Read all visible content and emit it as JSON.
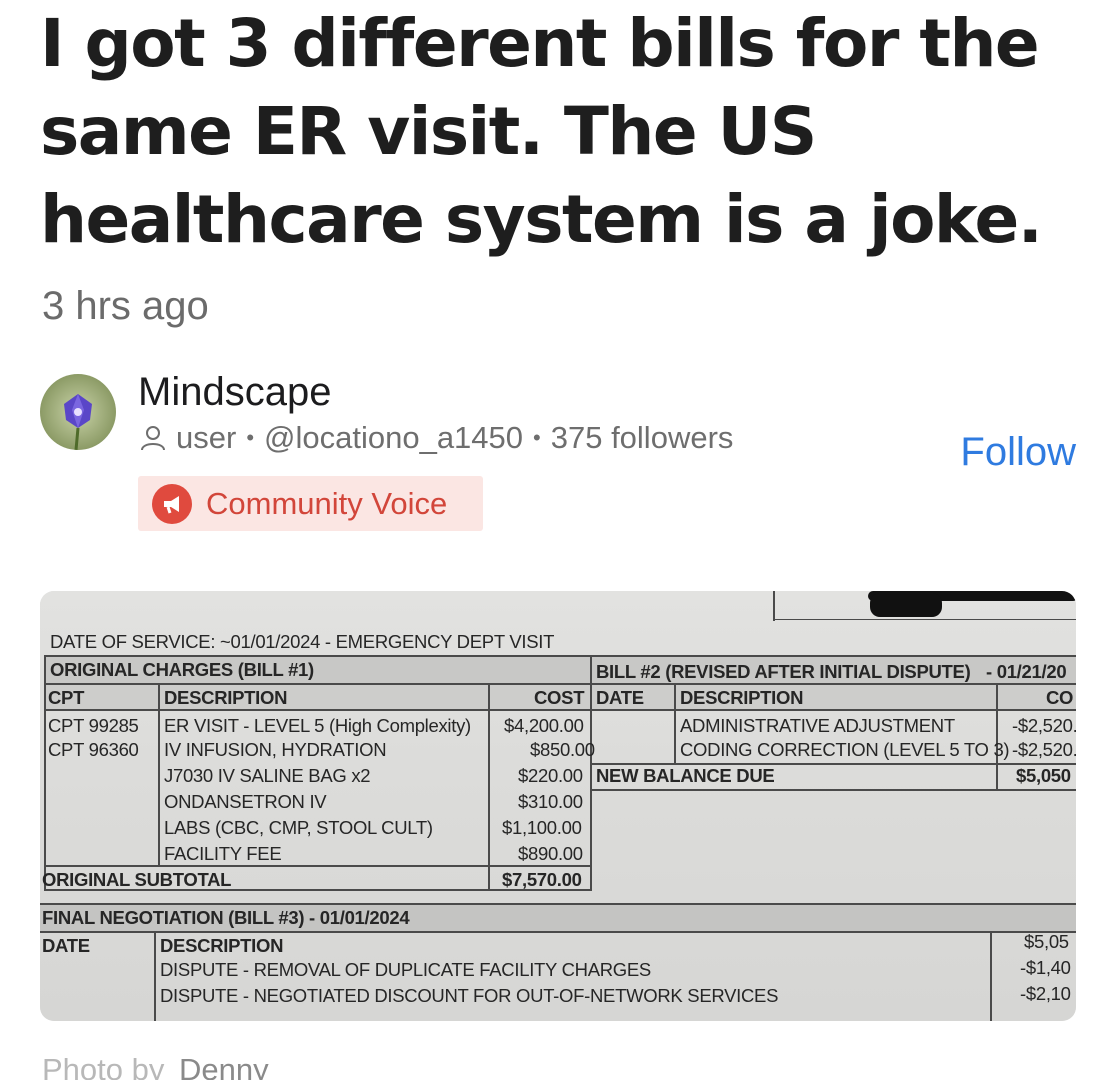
{
  "article": {
    "title": "I got 3 different bills for the same ER visit. The US healthcare system is a joke.",
    "timestamp": "3 hrs ago"
  },
  "author": {
    "name": "Mindscape",
    "role": "user",
    "handle": "@locationo_a1450",
    "followers": "375 followers",
    "follow_label": "Follow",
    "badge_label": "Community Voice",
    "role_icon": "user-icon",
    "badge_icon": "megaphone-icon"
  },
  "photo": {
    "caption_prefix": "Photo by",
    "caption_name": "Denny",
    "bill": {
      "date_of_service": "DATE OF SERVICE: ~01/01/2024 - EMERGENCY DEPT VISIT",
      "bill1": {
        "header": "ORIGINAL CHARGES (BILL #1)",
        "columns": [
          "CPT",
          "DESCRIPTION",
          "COST"
        ],
        "rows": [
          {
            "cpt": "CPT 99285",
            "desc": "ER VISIT - LEVEL 5 (High Complexity)",
            "cost": "$4,200.00"
          },
          {
            "cpt": "CPT 96360",
            "desc": "IV INFUSION, HYDRATION",
            "cost": "$850.00"
          },
          {
            "cpt": "",
            "desc": "J7030 IV SALINE BAG x2",
            "cost": "$220.00"
          },
          {
            "cpt": "",
            "desc": "ONDANSETRON IV",
            "cost": "$310.00"
          },
          {
            "cpt": "",
            "desc": "LABS (CBC, CMP, STOOL CULT)",
            "cost": "$1,100.00"
          },
          {
            "cpt": "",
            "desc": "FACILITY FEE",
            "cost": "$890.00"
          }
        ],
        "subtotal_label": "ORIGINAL SUBTOTAL",
        "subtotal_value": "$7,570.00"
      },
      "bill2": {
        "header": "BILL #2 (REVISED AFTER INITIAL DISPUTE)",
        "header_date": "- 01/21/20",
        "columns": [
          "DATE",
          "DESCRIPTION",
          "CO"
        ],
        "rows": [
          {
            "desc": "ADMINISTRATIVE ADJUSTMENT",
            "cost": "-$2,520."
          },
          {
            "desc": "CODING CORRECTION (LEVEL 5 TO 3)",
            "cost": "-$2,520."
          }
        ],
        "balance_label": "NEW BALANCE DUE",
        "balance_value": "$5,050"
      },
      "bill3": {
        "header": "FINAL NEGOTIATION (BILL #3) - 01/01/2024",
        "columns": [
          "DATE",
          "DESCRIPTION"
        ],
        "rows": [
          {
            "desc": "",
            "cost": "$5,05"
          },
          {
            "desc": "DISPUTE - REMOVAL OF DUPLICATE FACILITY CHARGES",
            "cost": "-$1,40"
          },
          {
            "desc": "DISPUTE - NEGOTIATED DISCOUNT FOR OUT-OF-NETWORK SERVICES",
            "cost": "-$2,10"
          }
        ]
      }
    }
  },
  "colors": {
    "accent": "#2f7be0",
    "badge_bg": "#fbe6e3",
    "badge_text": "#d2463a"
  }
}
